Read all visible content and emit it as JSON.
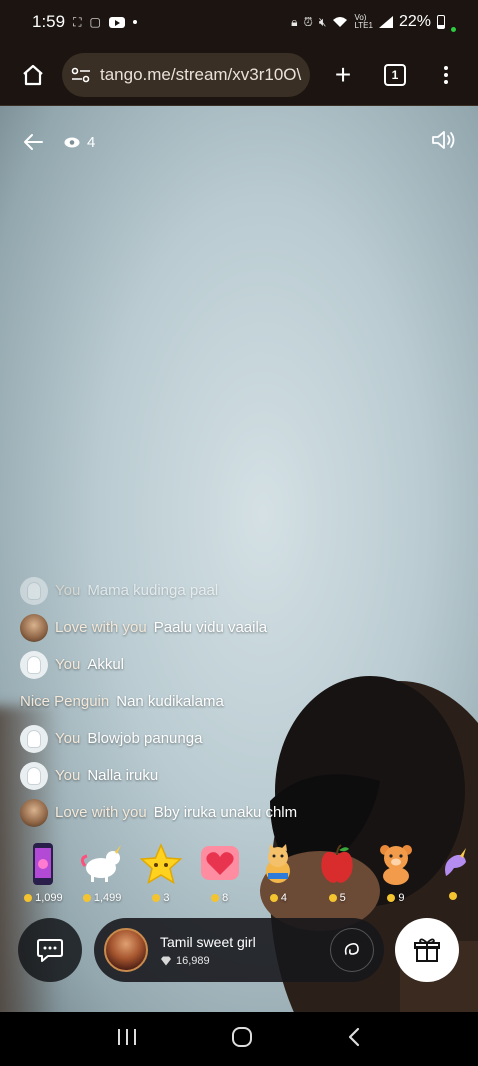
{
  "status_bar": {
    "time": "1:59",
    "battery": "22%"
  },
  "browser": {
    "url": "tango.me/stream/xv3r10O\\",
    "tab_count": "1"
  },
  "stream": {
    "viewer_count": "4"
  },
  "chat": [
    {
      "name": "You",
      "message": "Mama kudinga paal",
      "avatar": "ghost-avatar",
      "faded": true
    },
    {
      "name": "Love with you",
      "message": "Paalu vidu vaaila",
      "avatar": "photo-avatar"
    },
    {
      "name": "You",
      "message": "Akkul",
      "avatar": "ghost-avatar"
    },
    {
      "name": "Nice Penguin",
      "message": "Nan kudikalama",
      "avatar": "none"
    },
    {
      "name": "You",
      "message": "Blowjob panunga",
      "avatar": "ghost-avatar"
    },
    {
      "name": "You",
      "message": "Nalla iruku",
      "avatar": "ghost-avatar"
    },
    {
      "name": "Love with you",
      "message": "Bby iruka unaku chlm",
      "avatar": "photo-avatar"
    }
  ],
  "gifts": [
    {
      "icon": "phone-gift-icon",
      "price": "1,099"
    },
    {
      "icon": "unicorn-gift-icon",
      "price": "1,499"
    },
    {
      "icon": "star-gift-icon",
      "price": "3"
    },
    {
      "icon": "heart-gift-icon",
      "price": "8"
    },
    {
      "icon": "cat-gift-icon",
      "price": "4"
    },
    {
      "icon": "apple-gift-icon",
      "price": "5"
    },
    {
      "icon": "teddy-gift-icon",
      "price": "9"
    },
    {
      "icon": "unicorn-small-gift-icon",
      "price": ""
    }
  ],
  "streamer": {
    "name": "Tamil sweet girl",
    "diamonds": "16,989"
  },
  "colors": {
    "coin": "#f4c430",
    "heart": "#e8344e",
    "status_green": "#2ecc40"
  }
}
